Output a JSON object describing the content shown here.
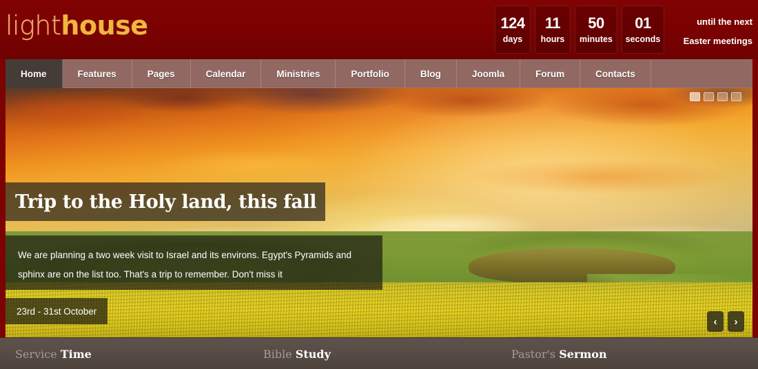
{
  "header": {
    "logo": {
      "part1": "light",
      "part2": "house"
    },
    "countdown": {
      "units": [
        {
          "value": "124",
          "label": "days"
        },
        {
          "value": "11",
          "label": "hours"
        },
        {
          "value": "50",
          "label": "minutes"
        },
        {
          "value": "01",
          "label": "seconds"
        }
      ],
      "caption_line1": "until the next",
      "caption_line2": "Easter meetings"
    },
    "bg_color": "#7d0202"
  },
  "nav": {
    "items": [
      {
        "label": "Home",
        "active": true
      },
      {
        "label": "Features",
        "active": false
      },
      {
        "label": "Pages",
        "active": false
      },
      {
        "label": "Calendar",
        "active": false
      },
      {
        "label": "Ministries",
        "active": false
      },
      {
        "label": "Portfolio",
        "active": false
      },
      {
        "label": "Blog",
        "active": false
      },
      {
        "label": "Joomla",
        "active": false
      },
      {
        "label": "Forum",
        "active": false
      },
      {
        "label": "Contacts",
        "active": false
      }
    ]
  },
  "slider": {
    "title": "Trip to the Holy land, this fall",
    "description": "We are planning a two week visit to Israel and its environs. Egypt's Pyramids and sphinx are on the list too. That's a trip to remember. Don't miss it",
    "date": "23rd - 31st October",
    "dots": [
      "1",
      "2",
      "3",
      "4"
    ],
    "active_dot": 0,
    "prev_label": "‹",
    "next_label": "›"
  },
  "footer": {
    "columns": [
      {
        "word1": "Service",
        "word2": "Time"
      },
      {
        "word1": "Bible",
        "word2": "Study"
      },
      {
        "word1": "Pastor's",
        "word2": "Sermon"
      }
    ]
  }
}
